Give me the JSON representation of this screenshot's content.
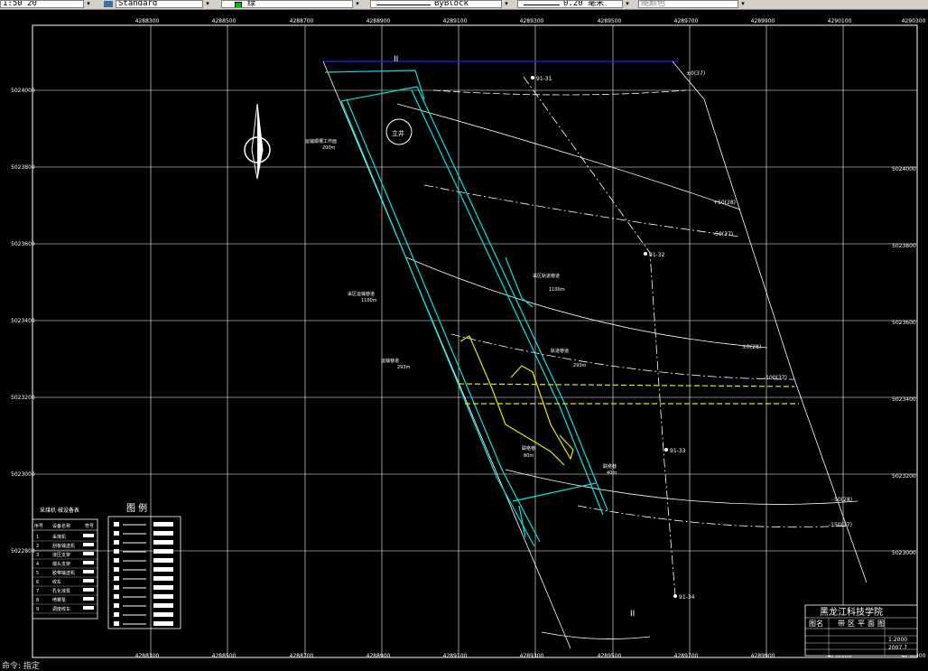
{
  "toolbar": {
    "scale_value": "1:50 20",
    "text_style": "Standard",
    "color_label": "绿",
    "linetype": "ByBlock",
    "lineweight": "0.20 毫米",
    "plot_style": "随颜色"
  },
  "grid": {
    "x_labels": [
      "4288300",
      "4288500",
      "4288700",
      "4288900",
      "4289100",
      "4289300",
      "4289500",
      "4289700",
      "4289900",
      "4290100",
      "4290300"
    ],
    "y_labels": [
      "5024000",
      "5023800",
      "5023600",
      "5023400",
      "5023200",
      "5023000",
      "5022800"
    ]
  },
  "annotations": {
    "section_top": "II",
    "section_bottom": "II",
    "drill_1": "91-31",
    "drill_2": "91-32",
    "drill_3": "91-33",
    "drill_4": "91-34",
    "coal_top": "±0(37)",
    "c1": "+50(28)",
    "c2": "-50(37)",
    "c3": "±0(28)",
    "c4": "-100(37)",
    "c5": "-50(28)",
    "c6": "-150(37)",
    "label_top_left": "运输顺槽工作面",
    "label_top_left_len": "200m",
    "label_mid_left": "采区运输巷道",
    "label_mid_left_len": "1100m",
    "label_mid_right": "采区轨道巷道",
    "label_mid_right_len": "1100m",
    "label_low_left": "运输巷道",
    "label_low_left_len": "293m",
    "label_low_right": "轨道巷道",
    "label_low_right_len": "293m",
    "label_bottom": "联络巷",
    "label_bottom_len": "80m",
    "label_bottom_r": "联络巷",
    "label_bottom_r_len": "40m",
    "mine_icon": "立井"
  },
  "equipment_table": {
    "title": "采煤机 械设备表",
    "headers": [
      "序号",
      "设备名称",
      "符号"
    ],
    "rows": [
      [
        "1",
        "采煤机"
      ],
      [
        "2",
        "刮板输送机"
      ],
      [
        "3",
        "液压支架"
      ],
      [
        "4",
        "端头支架"
      ],
      [
        "5",
        "胶带输送机"
      ],
      [
        "6",
        "绞车"
      ],
      [
        "7",
        "乳化液泵"
      ],
      [
        "8",
        "喷雾泵"
      ],
      [
        "9",
        "调度绞车"
      ]
    ]
  },
  "legend": {
    "title": "图    例"
  },
  "title_block": {
    "school": "黑龙江科技学院",
    "drawing_name_label": "图名",
    "drawing_name": "带区平面图",
    "scale": "1:2000",
    "date": "2007.7"
  },
  "bottom_status": "命令: 指定",
  "colors": {
    "grid": "#ffffff",
    "roadway": "#00ffff",
    "coal_seam": "#ffff00",
    "top_line": "#0000ff"
  }
}
